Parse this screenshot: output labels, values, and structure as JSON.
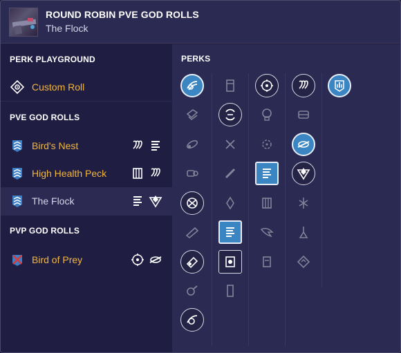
{
  "header": {
    "title": "ROUND ROBIN PVE GOD ROLLS",
    "subtitle": "The Flock",
    "thumbnail_icon": "weapon-thumbnail-icon"
  },
  "sidebar": {
    "perk_playground_heading": "PERK PLAYGROUND",
    "custom_roll_label": "Custom Roll",
    "pve_heading": "PVE GOD ROLLS",
    "pve_rolls": [
      {
        "label": "Bird's Nest",
        "perk_icons": [
          "stripes-perk-icon",
          "ammo-stack-icon"
        ]
      },
      {
        "label": "High Health Peck",
        "perk_icons": [
          "cylinder-perk-icon",
          "stripes-perk-icon"
        ]
      },
      {
        "label": "The Flock",
        "perk_icons": [
          "ammo-stack-icon",
          "triangle-perk-icon"
        ],
        "selected": true
      }
    ],
    "pvp_heading": "PVP GOD ROLLS",
    "pvp_rolls": [
      {
        "label": "Bird of Prey",
        "perk_icons": [
          "crosshair-perk-icon",
          "ring-slash-perk-icon"
        ]
      }
    ]
  },
  "perks": {
    "heading": "PERKS"
  },
  "colors": {
    "accent_gold": "#f2b73e",
    "selected_blue": "#3b86c2",
    "background": "#1f1c3b"
  }
}
